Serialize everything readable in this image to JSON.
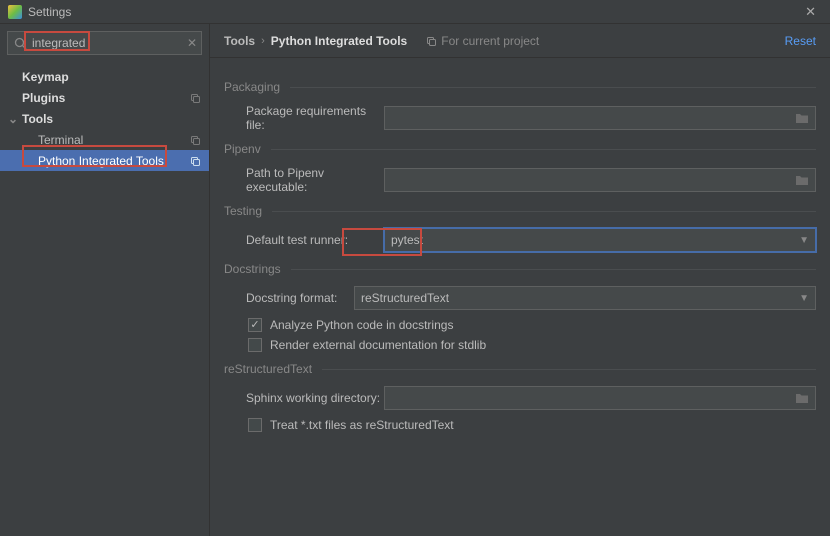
{
  "window": {
    "title": "Settings"
  },
  "sidebar": {
    "search_value": "integrated",
    "items": [
      {
        "label": "Keymap"
      },
      {
        "label": "Plugins"
      },
      {
        "label": "Tools"
      },
      {
        "label": "Terminal"
      },
      {
        "label": "Python Integrated Tools"
      }
    ]
  },
  "header": {
    "crumb_root": "Tools",
    "crumb_leaf": "Python Integrated Tools",
    "project_badge": "For current project",
    "reset": "Reset"
  },
  "packaging": {
    "section": "Packaging",
    "req_label": "Package requirements file:",
    "req_value": ""
  },
  "pipenv": {
    "section": "Pipenv",
    "exe_label": "Path to Pipenv executable:",
    "exe_value": ""
  },
  "testing": {
    "section": "Testing",
    "runner_label": "Default test runner:",
    "runner_value": "pytest"
  },
  "docstrings": {
    "section": "Docstrings",
    "format_label": "Docstring format:",
    "format_value": "reStructuredText",
    "analyze_label": "Analyze Python code in docstrings",
    "render_label": "Render external documentation for stdlib"
  },
  "rst": {
    "section": "reStructuredText",
    "sphinx_label": "Sphinx working directory:",
    "sphinx_value": "",
    "treat_txt_label": "Treat *.txt files as reStructuredText"
  }
}
